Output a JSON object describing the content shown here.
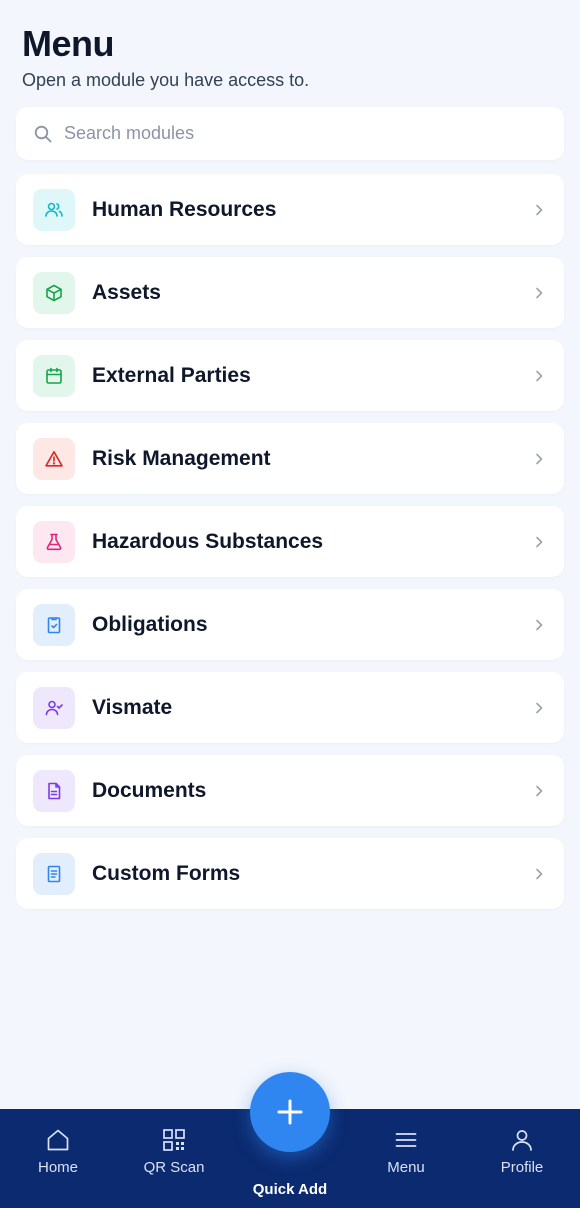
{
  "header": {
    "title": "Menu",
    "subtitle": "Open a module you have access to."
  },
  "search": {
    "placeholder": "Search modules",
    "value": "",
    "icon": "search-icon"
  },
  "modules": [
    {
      "label": "Human Resources",
      "icon": "users-icon",
      "bg": "#e0f7f9",
      "fg": "#14b8c8"
    },
    {
      "label": "Assets",
      "icon": "box-icon",
      "bg": "#e3f6ec",
      "fg": "#16a34a"
    },
    {
      "label": "External Parties",
      "icon": "calendar-icon",
      "bg": "#e3f6ec",
      "fg": "#16a34a"
    },
    {
      "label": "Risk Management",
      "icon": "warning-icon",
      "bg": "#fde8e6",
      "fg": "#dc2626"
    },
    {
      "label": "Hazardous Substances",
      "icon": "flask-icon",
      "bg": "#fde7f1",
      "fg": "#db2777"
    },
    {
      "label": "Obligations",
      "icon": "clipboard-check-icon",
      "bg": "#e3eefc",
      "fg": "#2f86f0"
    },
    {
      "label": "Vismate",
      "icon": "user-check-icon",
      "bg": "#efe8fc",
      "fg": "#7c3aed"
    },
    {
      "label": "Documents",
      "icon": "document-icon",
      "bg": "#efe8fc",
      "fg": "#7c3aed"
    },
    {
      "label": "Custom Forms",
      "icon": "form-icon",
      "bg": "#e3eefc",
      "fg": "#2f86f0"
    }
  ],
  "bottom_nav": {
    "home": {
      "label": "Home",
      "icon": "home-icon"
    },
    "qr_scan": {
      "label": "QR Scan",
      "icon": "qr-code-icon"
    },
    "quick_add": {
      "label": "Quick Add",
      "icon": "plus-icon"
    },
    "menu": {
      "label": "Menu",
      "icon": "hamburger-icon"
    },
    "profile": {
      "label": "Profile",
      "icon": "user-icon"
    }
  },
  "colors": {
    "background": "#f3f6fc",
    "nav_bar": "#0b2a6f",
    "accent": "#2f86f0"
  }
}
